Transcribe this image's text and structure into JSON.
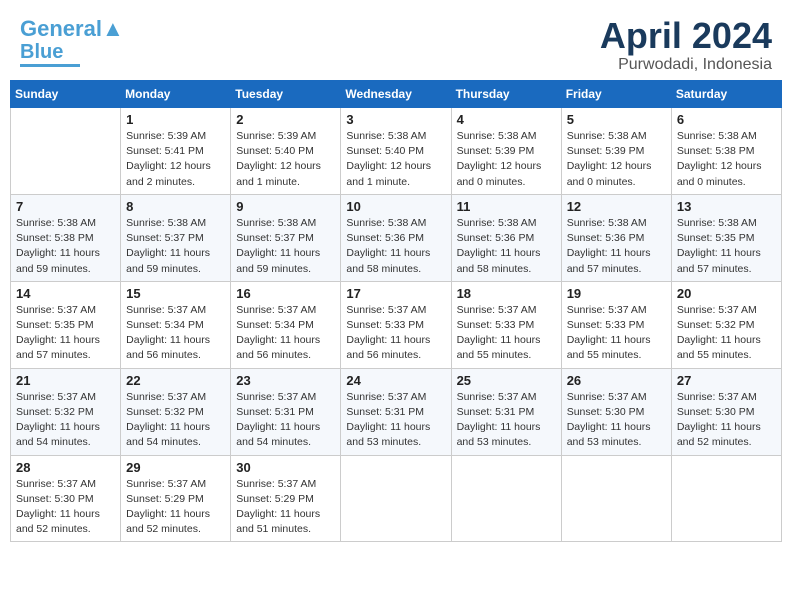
{
  "header": {
    "logo_line1": "General",
    "logo_line2": "Blue",
    "month": "April 2024",
    "location": "Purwodadi, Indonesia"
  },
  "days_of_week": [
    "Sunday",
    "Monday",
    "Tuesday",
    "Wednesday",
    "Thursday",
    "Friday",
    "Saturday"
  ],
  "weeks": [
    [
      {
        "day": "",
        "info": ""
      },
      {
        "day": "1",
        "info": "Sunrise: 5:39 AM\nSunset: 5:41 PM\nDaylight: 12 hours\nand 2 minutes."
      },
      {
        "day": "2",
        "info": "Sunrise: 5:39 AM\nSunset: 5:40 PM\nDaylight: 12 hours\nand 1 minute."
      },
      {
        "day": "3",
        "info": "Sunrise: 5:38 AM\nSunset: 5:40 PM\nDaylight: 12 hours\nand 1 minute."
      },
      {
        "day": "4",
        "info": "Sunrise: 5:38 AM\nSunset: 5:39 PM\nDaylight: 12 hours\nand 0 minutes."
      },
      {
        "day": "5",
        "info": "Sunrise: 5:38 AM\nSunset: 5:39 PM\nDaylight: 12 hours\nand 0 minutes."
      },
      {
        "day": "6",
        "info": "Sunrise: 5:38 AM\nSunset: 5:38 PM\nDaylight: 12 hours\nand 0 minutes."
      }
    ],
    [
      {
        "day": "7",
        "info": "Sunrise: 5:38 AM\nSunset: 5:38 PM\nDaylight: 11 hours\nand 59 minutes."
      },
      {
        "day": "8",
        "info": "Sunrise: 5:38 AM\nSunset: 5:37 PM\nDaylight: 11 hours\nand 59 minutes."
      },
      {
        "day": "9",
        "info": "Sunrise: 5:38 AM\nSunset: 5:37 PM\nDaylight: 11 hours\nand 59 minutes."
      },
      {
        "day": "10",
        "info": "Sunrise: 5:38 AM\nSunset: 5:36 PM\nDaylight: 11 hours\nand 58 minutes."
      },
      {
        "day": "11",
        "info": "Sunrise: 5:38 AM\nSunset: 5:36 PM\nDaylight: 11 hours\nand 58 minutes."
      },
      {
        "day": "12",
        "info": "Sunrise: 5:38 AM\nSunset: 5:36 PM\nDaylight: 11 hours\nand 57 minutes."
      },
      {
        "day": "13",
        "info": "Sunrise: 5:38 AM\nSunset: 5:35 PM\nDaylight: 11 hours\nand 57 minutes."
      }
    ],
    [
      {
        "day": "14",
        "info": "Sunrise: 5:37 AM\nSunset: 5:35 PM\nDaylight: 11 hours\nand 57 minutes."
      },
      {
        "day": "15",
        "info": "Sunrise: 5:37 AM\nSunset: 5:34 PM\nDaylight: 11 hours\nand 56 minutes."
      },
      {
        "day": "16",
        "info": "Sunrise: 5:37 AM\nSunset: 5:34 PM\nDaylight: 11 hours\nand 56 minutes."
      },
      {
        "day": "17",
        "info": "Sunrise: 5:37 AM\nSunset: 5:33 PM\nDaylight: 11 hours\nand 56 minutes."
      },
      {
        "day": "18",
        "info": "Sunrise: 5:37 AM\nSunset: 5:33 PM\nDaylight: 11 hours\nand 55 minutes."
      },
      {
        "day": "19",
        "info": "Sunrise: 5:37 AM\nSunset: 5:33 PM\nDaylight: 11 hours\nand 55 minutes."
      },
      {
        "day": "20",
        "info": "Sunrise: 5:37 AM\nSunset: 5:32 PM\nDaylight: 11 hours\nand 55 minutes."
      }
    ],
    [
      {
        "day": "21",
        "info": "Sunrise: 5:37 AM\nSunset: 5:32 PM\nDaylight: 11 hours\nand 54 minutes."
      },
      {
        "day": "22",
        "info": "Sunrise: 5:37 AM\nSunset: 5:32 PM\nDaylight: 11 hours\nand 54 minutes."
      },
      {
        "day": "23",
        "info": "Sunrise: 5:37 AM\nSunset: 5:31 PM\nDaylight: 11 hours\nand 54 minutes."
      },
      {
        "day": "24",
        "info": "Sunrise: 5:37 AM\nSunset: 5:31 PM\nDaylight: 11 hours\nand 53 minutes."
      },
      {
        "day": "25",
        "info": "Sunrise: 5:37 AM\nSunset: 5:31 PM\nDaylight: 11 hours\nand 53 minutes."
      },
      {
        "day": "26",
        "info": "Sunrise: 5:37 AM\nSunset: 5:30 PM\nDaylight: 11 hours\nand 53 minutes."
      },
      {
        "day": "27",
        "info": "Sunrise: 5:37 AM\nSunset: 5:30 PM\nDaylight: 11 hours\nand 52 minutes."
      }
    ],
    [
      {
        "day": "28",
        "info": "Sunrise: 5:37 AM\nSunset: 5:30 PM\nDaylight: 11 hours\nand 52 minutes."
      },
      {
        "day": "29",
        "info": "Sunrise: 5:37 AM\nSunset: 5:29 PM\nDaylight: 11 hours\nand 52 minutes."
      },
      {
        "day": "30",
        "info": "Sunrise: 5:37 AM\nSunset: 5:29 PM\nDaylight: 11 hours\nand 51 minutes."
      },
      {
        "day": "",
        "info": ""
      },
      {
        "day": "",
        "info": ""
      },
      {
        "day": "",
        "info": ""
      },
      {
        "day": "",
        "info": ""
      }
    ]
  ]
}
